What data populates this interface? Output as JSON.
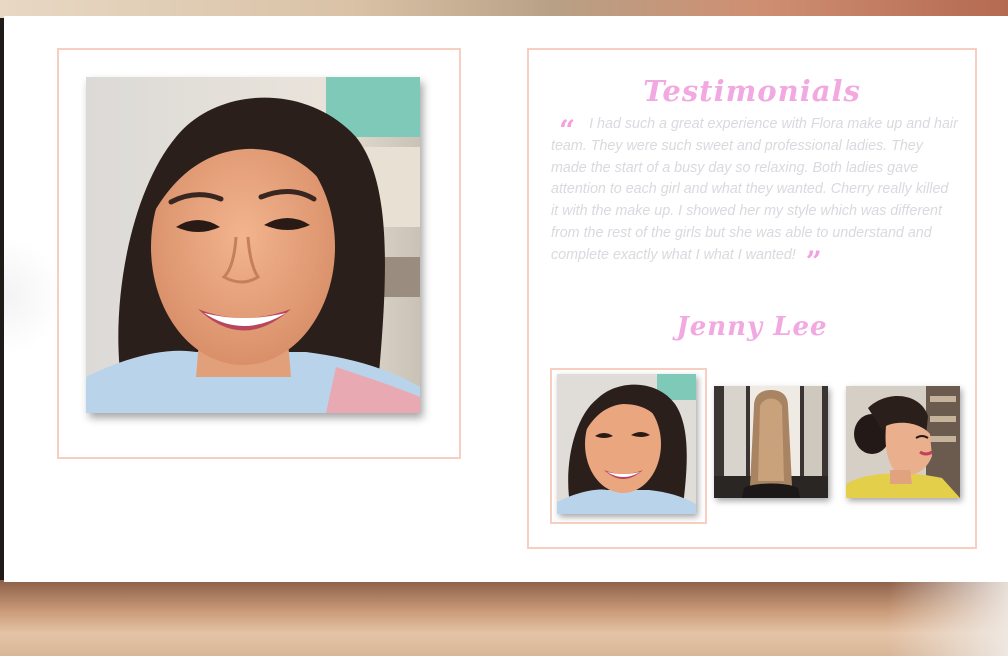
{
  "testimonials": {
    "title": "Testimonials",
    "quote_open": "“",
    "quote_text": "I had such a great experience with Flora make up and hair team. They were such sweet and professional ladies. They made the start of a busy day so relaxing. Both ladies gave attention to each girl and what they wanted. Cherry really killed it with the make up. I showed her my style which was different from the rest of the girls but she was able to understand and complete exactly what I what I wanted!",
    "quote_close": "”",
    "author": "Jenny Lee"
  },
  "gallery": {
    "selected_index": 0,
    "thumbnails": [
      {
        "subject": "smiling-portrait"
      },
      {
        "subject": "long-straight-hair-back-view"
      },
      {
        "subject": "updo-side-profile"
      }
    ]
  },
  "colors": {
    "accent_pink": "#f2a8e0",
    "frame_peach": "#f7cfc0",
    "quote_text": "#d9d9df"
  }
}
